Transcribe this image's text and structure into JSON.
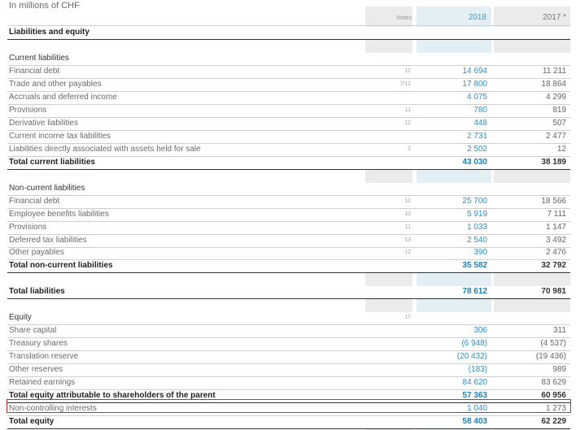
{
  "unit_label": "In millions of CHF",
  "columns": {
    "notes": "Notes",
    "y2018": "2018",
    "y2017": "2017 *"
  },
  "accent_colors": {
    "value_2018": "#2f8fc4",
    "highlight_border": "#d9262c"
  },
  "rows": [
    {
      "label": "Liabilities and equity",
      "note": "",
      "v2018": "",
      "v2017": "",
      "bold": true
    },
    {
      "label": "Current liabilities",
      "note": "",
      "v2018": "",
      "v2017": ""
    },
    {
      "label": "Financial debt",
      "note": "12",
      "v2018": "14 694",
      "v2017": "11 211"
    },
    {
      "label": "Trade and other payables",
      "note": "7/12",
      "v2018": "17 800",
      "v2017": "18 864"
    },
    {
      "label": "Accruals and deferred income",
      "note": "",
      "v2018": "4 075",
      "v2017": "4 299"
    },
    {
      "label": "Provisions",
      "note": "11",
      "v2018": "780",
      "v2017": "819"
    },
    {
      "label": "Derivative liabilities",
      "note": "12",
      "v2018": "448",
      "v2017": "507"
    },
    {
      "label": "Current income tax liabilities",
      "note": "",
      "v2018": "2 731",
      "v2017": "2 477"
    },
    {
      "label": "Liabilities directly associated with assets held for sale",
      "note": "2",
      "v2018": "2 502",
      "v2017": "12"
    },
    {
      "label": "Total current liabilities",
      "note": "",
      "v2018": "43 030",
      "v2017": "38 189",
      "bold": true
    },
    {
      "label": "Non-current liabilities",
      "note": "",
      "v2018": "",
      "v2017": ""
    },
    {
      "label": "Financial debt",
      "note": "12",
      "v2018": "25 700",
      "v2017": "18 566"
    },
    {
      "label": "Employee benefits liabilities",
      "note": "10",
      "v2018": "5 919",
      "v2017": "7 111"
    },
    {
      "label": "Provisions",
      "note": "11",
      "v2018": "1 033",
      "v2017": "1 147"
    },
    {
      "label": "Deferred tax liabilities",
      "note": "13",
      "v2018": "2 540",
      "v2017": "3 492"
    },
    {
      "label": "Other payables",
      "note": "12",
      "v2018": "390",
      "v2017": "2 476"
    },
    {
      "label": "Total non-current liabilities",
      "note": "",
      "v2018": "35 582",
      "v2017": "32 792",
      "bold": true
    },
    {
      "label": "Total liabilities",
      "note": "",
      "v2018": "78 612",
      "v2017": "70 981",
      "bold": true
    },
    {
      "label": "Equity",
      "note": "17",
      "v2018": "",
      "v2017": ""
    },
    {
      "label": "Share capital",
      "note": "",
      "v2018": "306",
      "v2017": "311"
    },
    {
      "label": "Treasury shares",
      "note": "",
      "v2018": "(6 948)",
      "v2017": "(4 537)"
    },
    {
      "label": "Translation reserve",
      "note": "",
      "v2018": "(20 432)",
      "v2017": "(19 436)"
    },
    {
      "label": "Other reserves",
      "note": "",
      "v2018": "(183)",
      "v2017": "989"
    },
    {
      "label": "Retained earnings",
      "note": "",
      "v2018": "84 620",
      "v2017": "83 629"
    },
    {
      "label": "Total equity attributable to shareholders of the parent",
      "note": "",
      "v2018": "57 363",
      "v2017": "60 956",
      "bold": true
    },
    {
      "label": "Non-controlling interests",
      "note": "",
      "v2018": "1 040",
      "v2017": "1 273",
      "highlighted": true
    },
    {
      "label": "Total equity",
      "note": "",
      "v2018": "58 403",
      "v2017": "62 229",
      "bold": true
    }
  ]
}
